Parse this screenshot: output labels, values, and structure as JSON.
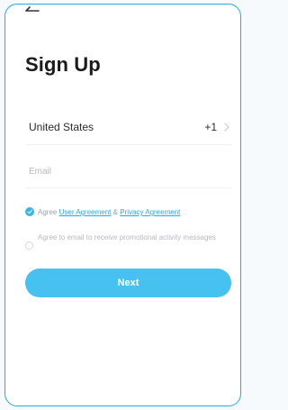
{
  "header": {
    "back_icon": "back-arrow-icon",
    "title": "Sign Up"
  },
  "country": {
    "name": "United States",
    "code": "+1",
    "chevron_icon": "chevron-right-icon"
  },
  "email": {
    "placeholder": "Email",
    "value": ""
  },
  "agreement": {
    "checked": true,
    "prefix": "Agree",
    "user_agreement_label": "User Agreement",
    "separator": "&",
    "privacy_agreement_label": "Privacy Agreement"
  },
  "promo": {
    "checked": false,
    "label": "Agree to email to receive promotional activity messages"
  },
  "actions": {
    "next_label": "Next"
  },
  "colors": {
    "accent": "#2aa8e0",
    "button": "#47c1ef",
    "frame_border": "#2aa8e0"
  }
}
